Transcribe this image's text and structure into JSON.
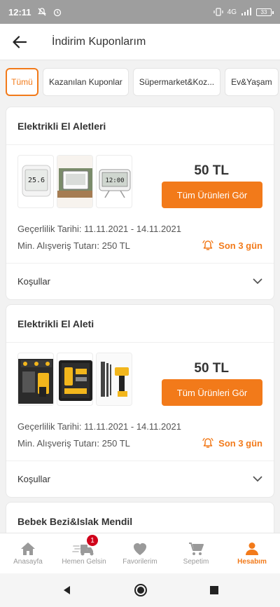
{
  "status_bar": {
    "time": "12:11",
    "network": "4G",
    "battery": "33"
  },
  "header": {
    "title": "İndirim Kuponlarım"
  },
  "tabs": [
    "Tümü",
    "Kazanılan Kuponlar",
    "Süpermarket&Koz...",
    "Ev&Yaşam"
  ],
  "coupons": [
    {
      "category": "Elektrikli El Aletleri",
      "amount": "50 TL",
      "cta": "Tüm Ürünleri Gör",
      "validity_label": "Geçerlilik Tarihi:",
      "validity_value": "11.11.2021 - 14.11.2021",
      "min_label": "Min. Alışveriş Tutarı:",
      "min_value": "250 TL",
      "days_left": "Son 3 gün",
      "conditions": "Koşullar"
    },
    {
      "category": "Elektrikli El Aleti",
      "amount": "50 TL",
      "cta": "Tüm Ürünleri Gör",
      "validity_label": "Geçerlilik Tarihi:",
      "validity_value": "11.11.2021 - 14.11.2021",
      "min_label": "Min. Alışveriş Tutarı:",
      "min_value": "250 TL",
      "days_left": "Son 3 gün",
      "conditions": "Koşullar"
    },
    {
      "category": "Bebek Bezi&Islak Mendil"
    }
  ],
  "product_thumbs": {
    "thermometer_readout": "25.6",
    "clock_readout": "12:00"
  },
  "bottom_nav": [
    {
      "label": "Anasayfa",
      "icon": "home-icon"
    },
    {
      "label": "Hemen Gelsin",
      "icon": "delivery-scooter-icon",
      "badge": "1"
    },
    {
      "label": "Favorilerim",
      "icon": "heart-icon"
    },
    {
      "label": "Sepetim",
      "icon": "cart-icon"
    },
    {
      "label": "Hesabım",
      "icon": "user-icon"
    }
  ],
  "colors": {
    "accent": "#f27a1a",
    "badge": "#d0021b",
    "inactive": "#9a9a9a"
  }
}
